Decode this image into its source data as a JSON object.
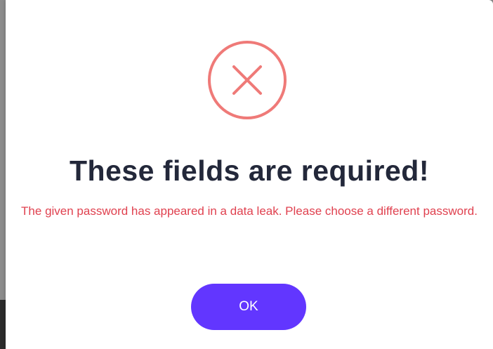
{
  "dialog": {
    "icon": "error-x-circle-icon",
    "title": "These fields are required!",
    "message": "The given password has appeared in a data leak. Please choose a different password.",
    "ok_label": "OK"
  },
  "colors": {
    "icon_accent": "#ef7a78",
    "title_text": "#23283a",
    "message_text": "#e0414f",
    "button_bg": "#6236ff",
    "button_text": "#ffffff"
  }
}
